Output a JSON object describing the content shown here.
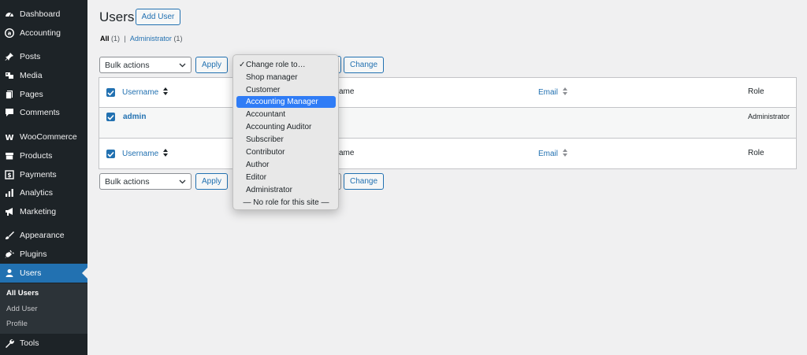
{
  "sidebar": {
    "items": [
      {
        "label": "Dashboard",
        "icon": "dashboard-icon"
      },
      {
        "label": "Accounting",
        "icon": "accounting-icon"
      },
      {
        "label": "Posts",
        "icon": "pin-icon"
      },
      {
        "label": "Media",
        "icon": "media-icon"
      },
      {
        "label": "Pages",
        "icon": "pages-icon"
      },
      {
        "label": "Comments",
        "icon": "comments-icon"
      },
      {
        "label": "WooCommerce",
        "icon": "woocommerce-icon"
      },
      {
        "label": "Products",
        "icon": "products-icon"
      },
      {
        "label": "Payments",
        "icon": "payments-icon"
      },
      {
        "label": "Analytics",
        "icon": "analytics-icon"
      },
      {
        "label": "Marketing",
        "icon": "megaphone-icon"
      },
      {
        "label": "Appearance",
        "icon": "brush-icon"
      },
      {
        "label": "Plugins",
        "icon": "plugin-icon"
      },
      {
        "label": "Users",
        "icon": "user-icon"
      },
      {
        "label": "Tools",
        "icon": "wrench-icon"
      }
    ],
    "submenu": [
      "All Users",
      "Add User",
      "Profile"
    ]
  },
  "page": {
    "title": "Users",
    "add_user": "Add User"
  },
  "views": {
    "all": "All",
    "all_count": "(1)",
    "separator": "|",
    "administrator": "Administrator",
    "administrator_count": "(1)"
  },
  "bulk": {
    "label": "Bulk actions",
    "apply": "Apply",
    "change": "Change"
  },
  "table": {
    "headers": {
      "username": "Username",
      "name": "ame",
      "email": "Email",
      "role": "Role"
    },
    "rows": [
      {
        "username": "admin",
        "role": "Administrator"
      }
    ]
  },
  "role_menu": {
    "options": [
      "Change role to…",
      "Shop manager",
      "Customer",
      "Accounting Manager",
      "Accountant",
      "Accounting Auditor",
      "Subscriber",
      "Contributor",
      "Author",
      "Editor",
      "Administrator",
      "— No role for this site —"
    ],
    "checkmark": "✓"
  },
  "colors": {
    "sidebar_bg": "#1d2327",
    "accent": "#2271b1",
    "highlight": "#2f7cf6"
  }
}
